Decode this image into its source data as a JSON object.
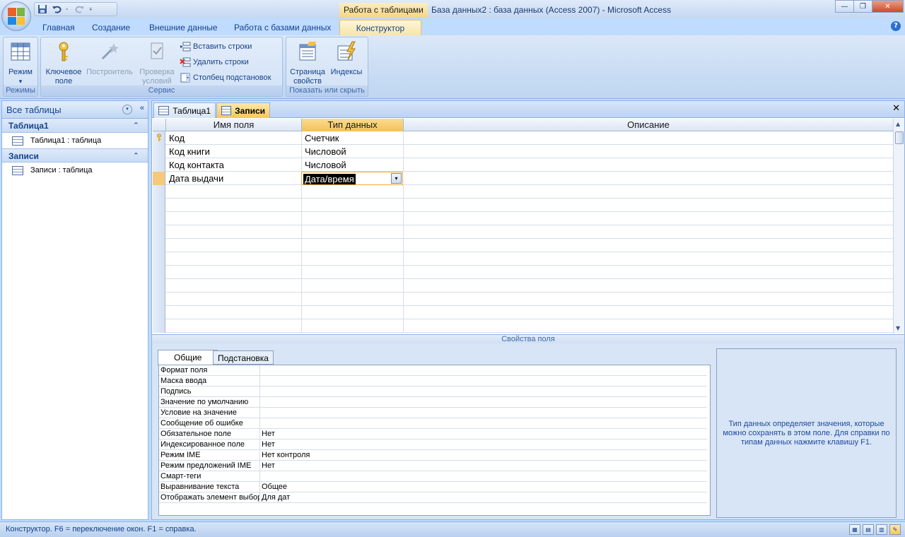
{
  "titlebar": {
    "context_label": "Работа с таблицами",
    "title": "База данных2 : база данных (Access 2007) - Microsoft Access",
    "minimize": "—",
    "maximize": "❐",
    "close": "✕"
  },
  "ribbon_tabs": [
    "Главная",
    "Создание",
    "Внешние данные",
    "Работа с базами данных",
    "Конструктор"
  ],
  "help": "?",
  "ribbon": {
    "groups": {
      "modes": "Режимы",
      "service": "Сервис",
      "show_hide": "Показать или скрыть"
    },
    "buttons": {
      "mode": "Режим",
      "mode_arrow": "▾",
      "key_field_1": "Ключевое",
      "key_field_2": "поле",
      "builder": "Построитель",
      "check_1": "Проверка",
      "check_2": "условий",
      "insert_rows": "Вставить строки",
      "delete_rows": "Удалить строки",
      "lookup_column": "Столбец  подстановок",
      "property_sheet_1": "Страница",
      "property_sheet_2": "свойств",
      "indexes": "Индексы"
    }
  },
  "nav": {
    "header": "Все таблицы",
    "dropdown": "▾",
    "collapse": "«",
    "groups": [
      {
        "name": "Таблица1",
        "chevron": "⌃",
        "items": [
          "Таблица1 : таблица"
        ]
      },
      {
        "name": "Записи",
        "chevron": "⌃",
        "items": [
          "Записи : таблица"
        ]
      }
    ]
  },
  "doc_tabs": [
    "Таблица1",
    "Записи"
  ],
  "doc_close": "✕",
  "design_grid": {
    "headers": [
      "Имя поля",
      "Тип данных",
      "Описание"
    ],
    "rows": [
      {
        "field": "Код",
        "type": "Счетчик",
        "primary_key": true
      },
      {
        "field": "Код книги",
        "type": "Числовой"
      },
      {
        "field": "Код контакта",
        "type": "Числовой"
      },
      {
        "field": "Дата выдачи",
        "type": "Дата/время",
        "current": true
      }
    ],
    "combo_arrow": "▾"
  },
  "properties": {
    "title": "Свойства поля",
    "tabs": [
      "Общие",
      "Подстановка"
    ],
    "rows": [
      {
        "name": "Формат поля",
        "value": ""
      },
      {
        "name": "Маска ввода",
        "value": ""
      },
      {
        "name": "Подпись",
        "value": ""
      },
      {
        "name": "Значение по умолчанию",
        "value": ""
      },
      {
        "name": "Условие на значение",
        "value": ""
      },
      {
        "name": "Сообщение об ошибке",
        "value": ""
      },
      {
        "name": "Обязательное поле",
        "value": "Нет"
      },
      {
        "name": "Индексированное поле",
        "value": "Нет"
      },
      {
        "name": "Режим IME",
        "value": "Нет контроля"
      },
      {
        "name": "Режим предложений IME",
        "value": "Нет"
      },
      {
        "name": "Смарт-теги",
        "value": ""
      },
      {
        "name": "Выравнивание текста",
        "value": "Общее"
      },
      {
        "name": "Отображать элемент выбора даты",
        "value": "Для дат"
      }
    ],
    "help_text": "Тип данных определяет значения, которые можно сохранять в этом поле.  Для справки по типам данных нажмите клавишу F1."
  },
  "statusbar": {
    "text": "Конструктор.  F6 = переключение окон.  F1 = справка."
  }
}
